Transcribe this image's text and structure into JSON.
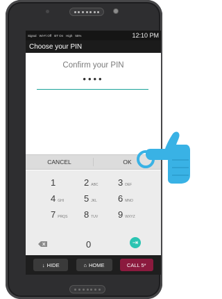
{
  "status_bar": {
    "left_items": [
      "Signal",
      "Wi-Fi Off",
      "BT On",
      "High",
      "55%"
    ],
    "time": "12:10 PM"
  },
  "app_bar": {
    "title": "Choose your PIN"
  },
  "pin_screen": {
    "prompt": "Confirm your PIN",
    "masked_value": "••••"
  },
  "actions": {
    "cancel": "CANCEL",
    "ok": "OK"
  },
  "keypad": {
    "keys": [
      {
        "digit": "1",
        "letters": ""
      },
      {
        "digit": "2",
        "letters": "ABC"
      },
      {
        "digit": "3",
        "letters": "DEF"
      },
      {
        "digit": "4",
        "letters": "GHI"
      },
      {
        "digit": "5",
        "letters": "JKL"
      },
      {
        "digit": "6",
        "letters": "MNO"
      },
      {
        "digit": "7",
        "letters": "PRQS"
      },
      {
        "digit": "8",
        "letters": "TUV"
      },
      {
        "digit": "9",
        "letters": "WXYZ"
      },
      {
        "digit": "0",
        "letters": ""
      }
    ],
    "delete_icon": "backspace-icon",
    "enter_icon": "go-arrow-icon"
  },
  "nav_bar": {
    "hide": "HIDE",
    "home": "HOME",
    "call": "CALL 5*"
  },
  "colors": {
    "accent_teal": "#1aa39a",
    "tap_blue": "#39b2e5",
    "call_button": "#8b1a3e"
  }
}
